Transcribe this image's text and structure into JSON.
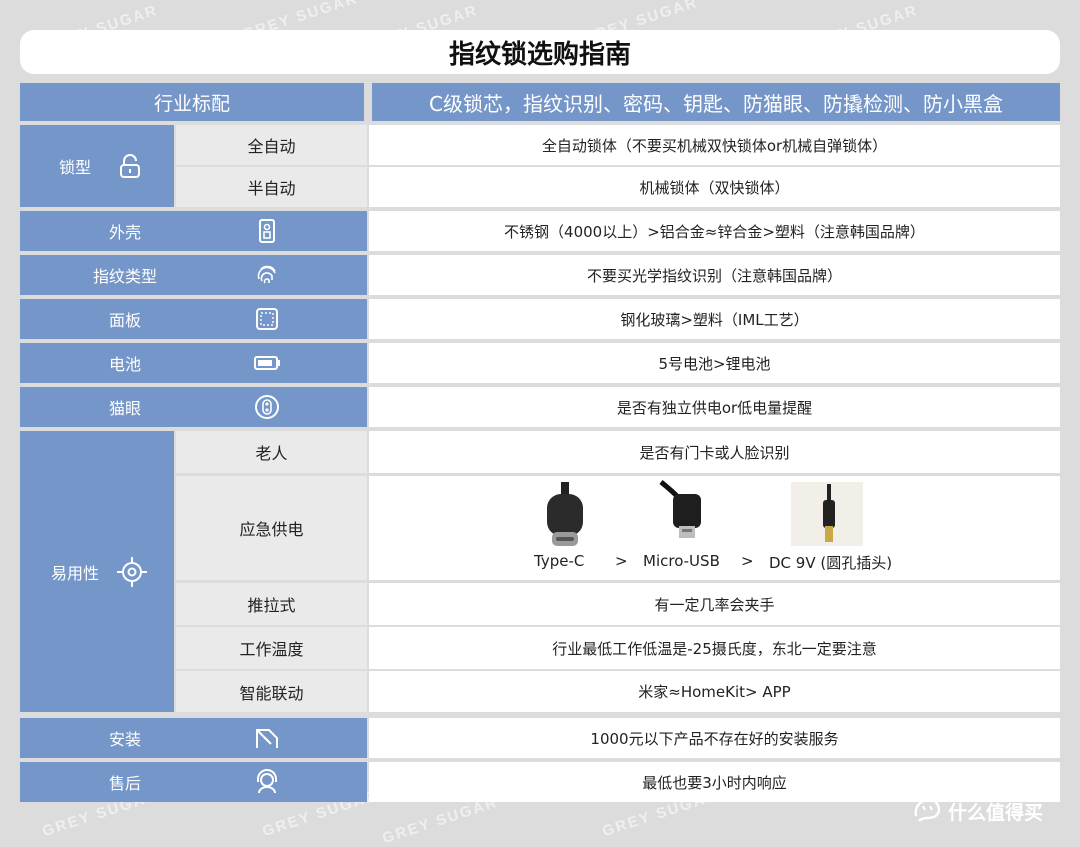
{
  "title": "指纹锁选购指南",
  "watermark": "GREY SUGAR",
  "header": {
    "label": "行业标配",
    "value": "C级锁芯，指纹识别、密码、钥匙、防猫眼、防撬检测、防小黑盒"
  },
  "lock_type": {
    "label": "锁型",
    "icon": "lock-icon",
    "rows": [
      {
        "sub": "全自动",
        "value": "全自动锁体（不要买机械双快锁体or机械自弹锁体）"
      },
      {
        "sub": "半自动",
        "value": "机械锁体（双快锁体）"
      }
    ]
  },
  "simple_rows": [
    {
      "label": "外壳",
      "icon": "door-panel-icon",
      "value": "不锈钢（4000以上）>铝合金≈锌合金>塑料（注意韩国品牌）"
    },
    {
      "label": "指纹类型",
      "icon": "fingerprint-icon",
      "value": "不要买光学指纹识别（注意韩国品牌）"
    },
    {
      "label": "面板",
      "icon": "panel-icon",
      "value": "钢化玻璃>塑料（IML工艺）"
    },
    {
      "label": "电池",
      "icon": "battery-icon",
      "value": "5号电池>锂电池"
    },
    {
      "label": "猫眼",
      "icon": "peephole-icon",
      "value": "是否有独立供电or低电量提醒"
    }
  ],
  "usability": {
    "label": "易用性",
    "icon": "target-icon",
    "rows": [
      {
        "sub": "老人",
        "value": "是否有门卡或人脸识别"
      },
      {
        "sub": "应急供电",
        "value": ""
      },
      {
        "sub": "推拉式",
        "value": "有一定几率会夹手"
      },
      {
        "sub": "工作温度",
        "value": "行业最低工作低温是-25摄氏度，东北一定要注意"
      },
      {
        "sub": "智能联动",
        "value": "米家≈HomeKit> APP"
      }
    ],
    "emergency": {
      "typec": "Type-C",
      "sep1": ">",
      "micro": "Micro-USB",
      "sep2": ">",
      "dc": "DC 9V (圆孔插头)"
    }
  },
  "bottom_rows": [
    {
      "label": "安装",
      "icon": "install-icon",
      "value": "1000元以下产品不存在好的安装服务"
    },
    {
      "label": "售后",
      "icon": "support-icon",
      "value": "最低也要3小时内响应"
    }
  ],
  "footer": {
    "brand": "什么值得买",
    "logo_icon": "smzdm-logo-icon"
  },
  "colors": {
    "accent_blue": "#7496c9",
    "background": "#dcdcdc",
    "sub_gray": "#eaeaea",
    "cell_white": "#ffffff"
  }
}
